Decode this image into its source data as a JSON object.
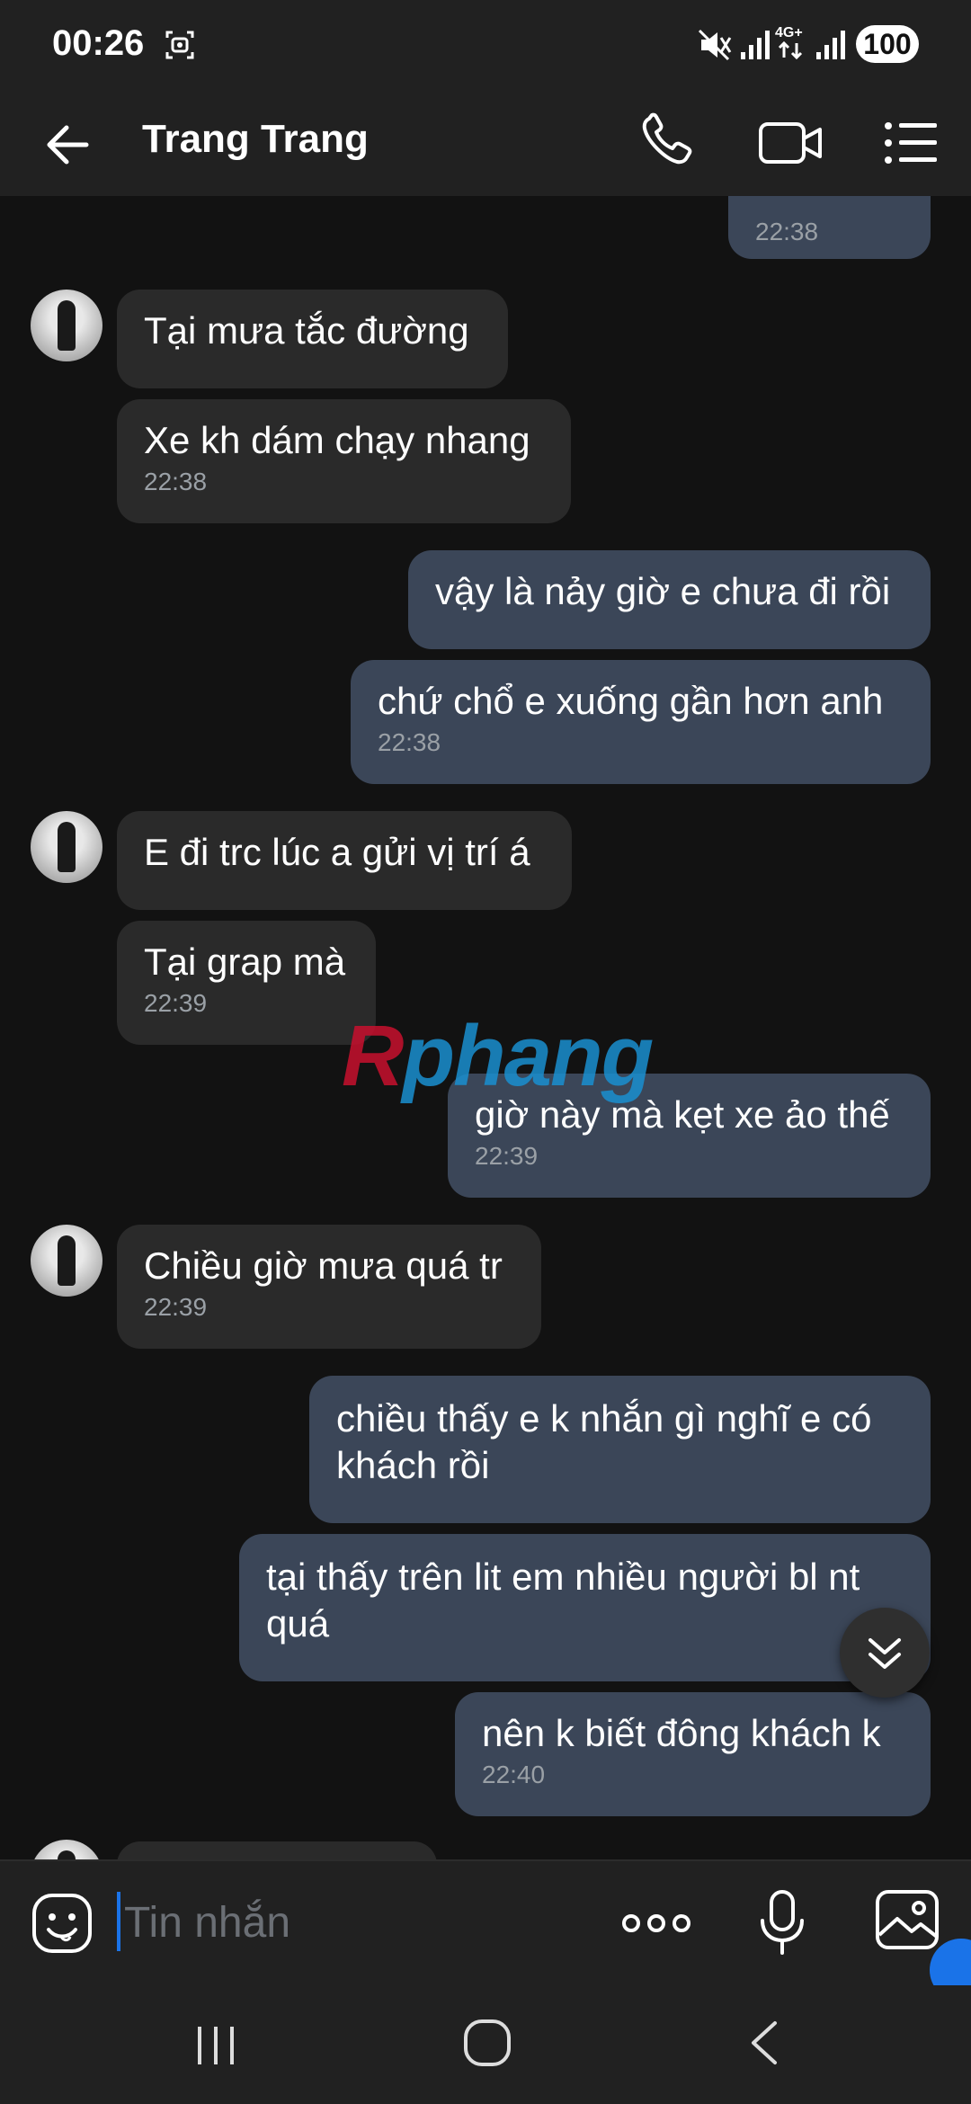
{
  "status_bar": {
    "time": "00:26",
    "network": "4G+",
    "battery": "100"
  },
  "header": {
    "title": "Trang Trang"
  },
  "messages": [
    {
      "dir": "out",
      "text": "",
      "time": "22:38"
    },
    {
      "dir": "in",
      "text": "Tại mưa tắc đường",
      "time": ""
    },
    {
      "dir": "in",
      "text": "Xe kh dám chạy nhang",
      "time": "22:38"
    },
    {
      "dir": "out",
      "text": "vậy là nảy giờ e chưa đi rồi",
      "time": ""
    },
    {
      "dir": "out",
      "text": "chứ chổ e xuống gần hơn anh",
      "time": "22:38"
    },
    {
      "dir": "in",
      "text": "E đi trc lúc a gửi vị trí á",
      "time": ""
    },
    {
      "dir": "in",
      "text": "Tại grap mà",
      "time": "22:39"
    },
    {
      "dir": "out",
      "text": "giờ này mà kẹt xe ảo thế",
      "time": "22:39"
    },
    {
      "dir": "in",
      "text": "Chiều giờ mưa quá tr",
      "time": "22:39"
    },
    {
      "dir": "out",
      "text": "chiều thấy e k nhắn gì nghĩ e có khách rồi",
      "time": ""
    },
    {
      "dir": "out",
      "text": "tại thấy trên lit em nhiều người bl nt quá",
      "time": ""
    },
    {
      "dir": "out",
      "text": "nên k biết đông khách k",
      "time": "22:40"
    }
  ],
  "watermark": {
    "part1": "R",
    "part2": "phang"
  },
  "input": {
    "placeholder": "Tin nhắn"
  }
}
